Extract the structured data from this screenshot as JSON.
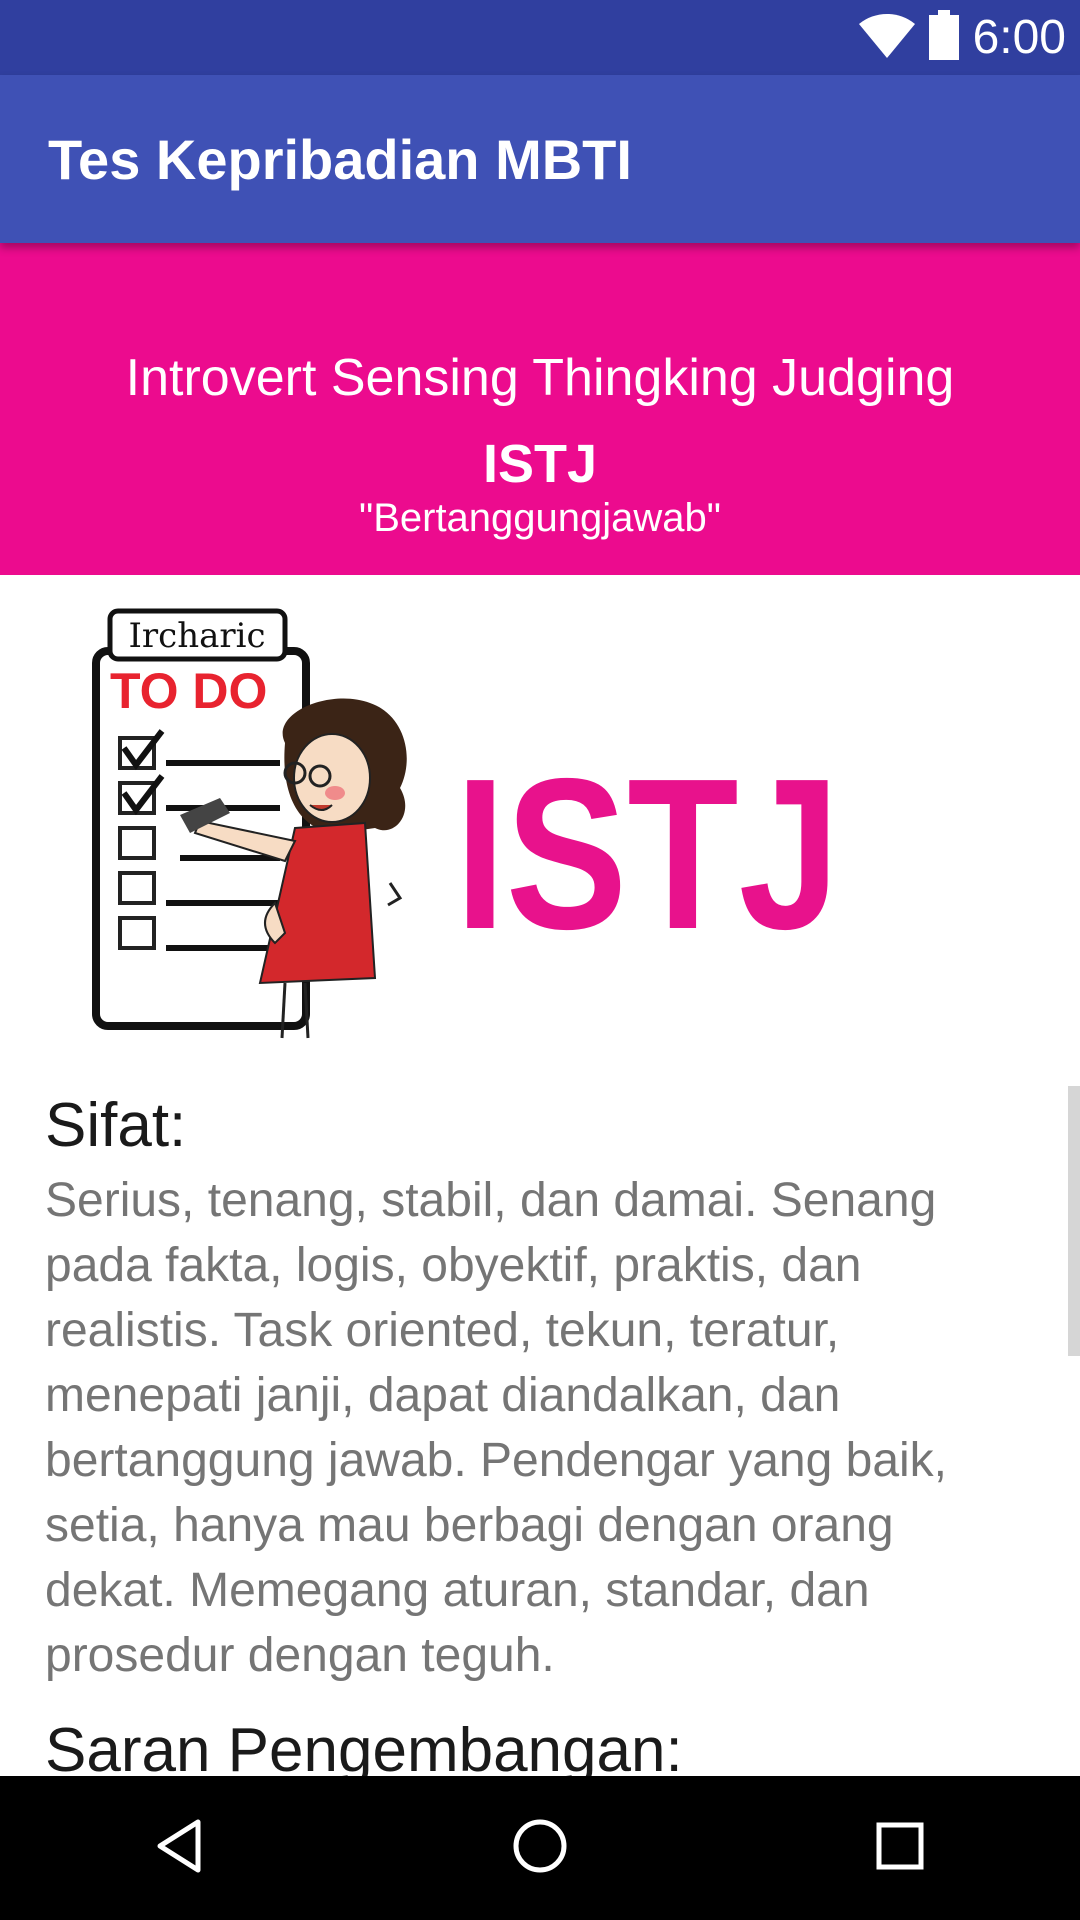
{
  "status_bar": {
    "time": "6:00",
    "icons": [
      "wifi-icon",
      "battery-icon"
    ]
  },
  "app_bar": {
    "title": "Tes Kepribadian MBTI"
  },
  "banner": {
    "type_name": "Introvert Sensing Thingking Judging",
    "type_code": "ISTJ",
    "nickname": "\"Bertanggungjawab\""
  },
  "illustration": {
    "caption_top": "Ircharic",
    "todo_label": "TO DO",
    "logo_text": "ISTJ"
  },
  "sections": [
    {
      "title": "Sifat:",
      "body": "Serius, tenang, stabil, dan damai. Senang pada fakta, logis, obyektif, praktis, dan realistis. Task oriented, tekun, teratur, menepati janji, dapat diandalkan, dan bertanggung jawab. Pendengar yang baik, setia, hanya mau berbagi dengan orang dekat. Memegang aturan, standar, dan prosedur dengan teguh."
    },
    {
      "title": "Saran Pengembangan:"
    }
  ],
  "colors": {
    "status_bar": "#303f9f",
    "app_bar": "#3f51b5",
    "banner": "#ec0b8e",
    "accent_pink": "#e8128c",
    "body_text": "#757575"
  },
  "nav_bar": {
    "buttons": [
      "back-icon",
      "home-icon",
      "recents-icon"
    ]
  }
}
